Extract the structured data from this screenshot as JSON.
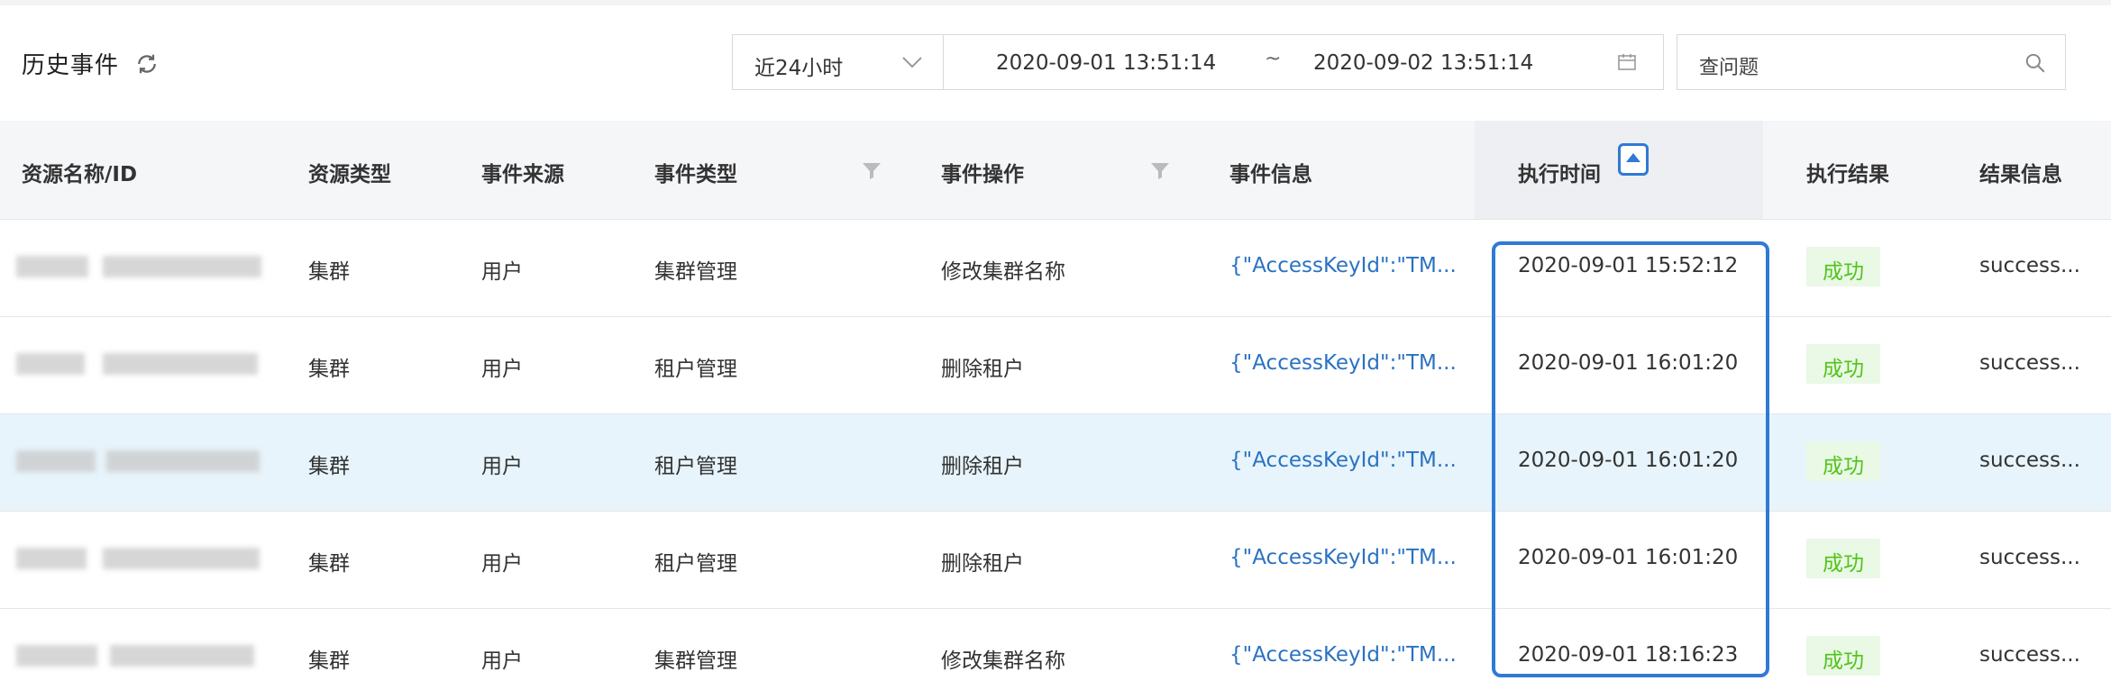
{
  "header": {
    "title": "历史事件",
    "time_range": "近24小时",
    "date_start": "2020-09-01 13:51:14",
    "date_separator": "~",
    "date_end": "2020-09-02 13:51:14",
    "search_placeholder": "查问题"
  },
  "columns": {
    "resource": "资源名称/ID",
    "resource_type": "资源类型",
    "event_source": "事件来源",
    "event_type": "事件类型",
    "event_action": "事件操作",
    "event_info": "事件信息",
    "exec_time": "执行时间",
    "exec_result": "执行结果",
    "result_info": "结果信息"
  },
  "rows": [
    {
      "resource_type": "集群",
      "event_source": "用户",
      "event_type": "集群管理",
      "event_action": "修改集群名称",
      "event_info": "{\"AccessKeyId\":\"TM...",
      "exec_time": "2020-09-01 15:52:12",
      "exec_result": "成功",
      "result_info": "success..."
    },
    {
      "resource_type": "集群",
      "event_source": "用户",
      "event_type": "租户管理",
      "event_action": "删除租户",
      "event_info": "{\"AccessKeyId\":\"TM...",
      "exec_time": "2020-09-01 16:01:20",
      "exec_result": "成功",
      "result_info": "success..."
    },
    {
      "resource_type": "集群",
      "event_source": "用户",
      "event_type": "租户管理",
      "event_action": "删除租户",
      "event_info": "{\"AccessKeyId\":\"TM...",
      "exec_time": "2020-09-01 16:01:20",
      "exec_result": "成功",
      "result_info": "success..."
    },
    {
      "resource_type": "集群",
      "event_source": "用户",
      "event_type": "租户管理",
      "event_action": "删除租户",
      "event_info": "{\"AccessKeyId\":\"TM...",
      "exec_time": "2020-09-01 16:01:20",
      "exec_result": "成功",
      "result_info": "success..."
    },
    {
      "resource_type": "集群",
      "event_source": "用户",
      "event_type": "集群管理",
      "event_action": "修改集群名称",
      "event_info": "{\"AccessKeyId\":\"TM...",
      "exec_time": "2020-09-01 18:16:23",
      "exec_result": "成功",
      "result_info": "success..."
    }
  ],
  "colors": {
    "accent": "#2f7ad6",
    "link": "#2a72c2",
    "success_text": "#52c41a",
    "success_bg": "#eaf8e6",
    "highlight_row": "#e7f4fb"
  },
  "icons": [
    "refresh-icon",
    "chevron-down-icon",
    "calendar-icon",
    "search-icon",
    "filter-icon",
    "sort-up-icon"
  ]
}
